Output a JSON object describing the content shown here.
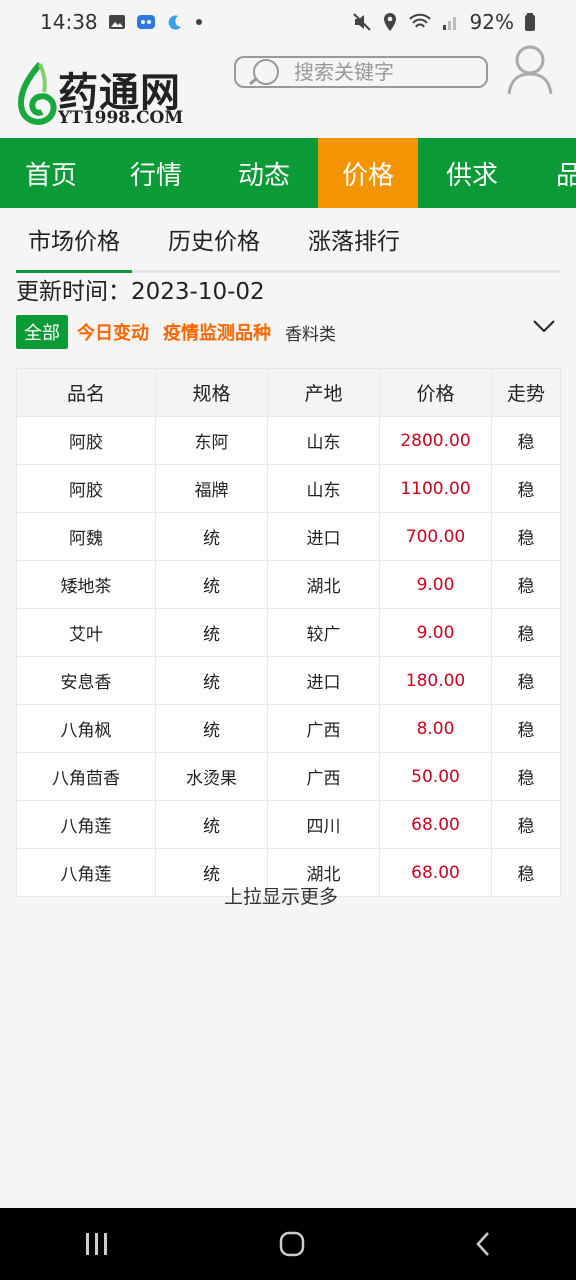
{
  "status": {
    "time": "14:38",
    "battery": "92%"
  },
  "logo": {
    "name": "药通网",
    "domain": "YT1998.COM"
  },
  "search": {
    "placeholder": "搜索关键字"
  },
  "nav": {
    "items": [
      {
        "label": "首页"
      },
      {
        "label": "行情"
      },
      {
        "label": "动态"
      },
      {
        "label": "价格"
      },
      {
        "label": "供求"
      },
      {
        "label": "品"
      }
    ],
    "active": "价格"
  },
  "subtabs": [
    {
      "label": "市场价格"
    },
    {
      "label": "历史价格"
    },
    {
      "label": "涨落排行"
    }
  ],
  "update": {
    "label": "更新时间：",
    "date": "2023-10-02"
  },
  "filters": {
    "all": "全部",
    "today": "今日变动",
    "epidemic": "疫情监测品种",
    "spice": "香料类"
  },
  "table": {
    "headers": [
      "品名",
      "规格",
      "产地",
      "价格",
      "走势"
    ],
    "rows": [
      [
        "阿胶",
        "东阿",
        "山东",
        "2800.00",
        "稳"
      ],
      [
        "阿胶",
        "福牌",
        "山东",
        "1100.00",
        "稳"
      ],
      [
        "阿魏",
        "统",
        "进口",
        "700.00",
        "稳"
      ],
      [
        "矮地茶",
        "统",
        "湖北",
        "9.00",
        "稳"
      ],
      [
        "艾叶",
        "统",
        "较广",
        "9.00",
        "稳"
      ],
      [
        "安息香",
        "统",
        "进口",
        "180.00",
        "稳"
      ],
      [
        "八角枫",
        "统",
        "广西",
        "8.00",
        "稳"
      ],
      [
        "八角茴香",
        "水烫果",
        "广西",
        "50.00",
        "稳"
      ],
      [
        "八角莲",
        "统",
        "四川",
        "68.00",
        "稳"
      ],
      [
        "八角莲",
        "统",
        "湖北",
        "68.00",
        "稳"
      ]
    ]
  },
  "more": "上拉显示更多",
  "colors": {
    "brand_green": "#0a9b36",
    "active_orange": "#f39400",
    "price_red": "#d6001c",
    "tag_orange": "#ff6600"
  }
}
